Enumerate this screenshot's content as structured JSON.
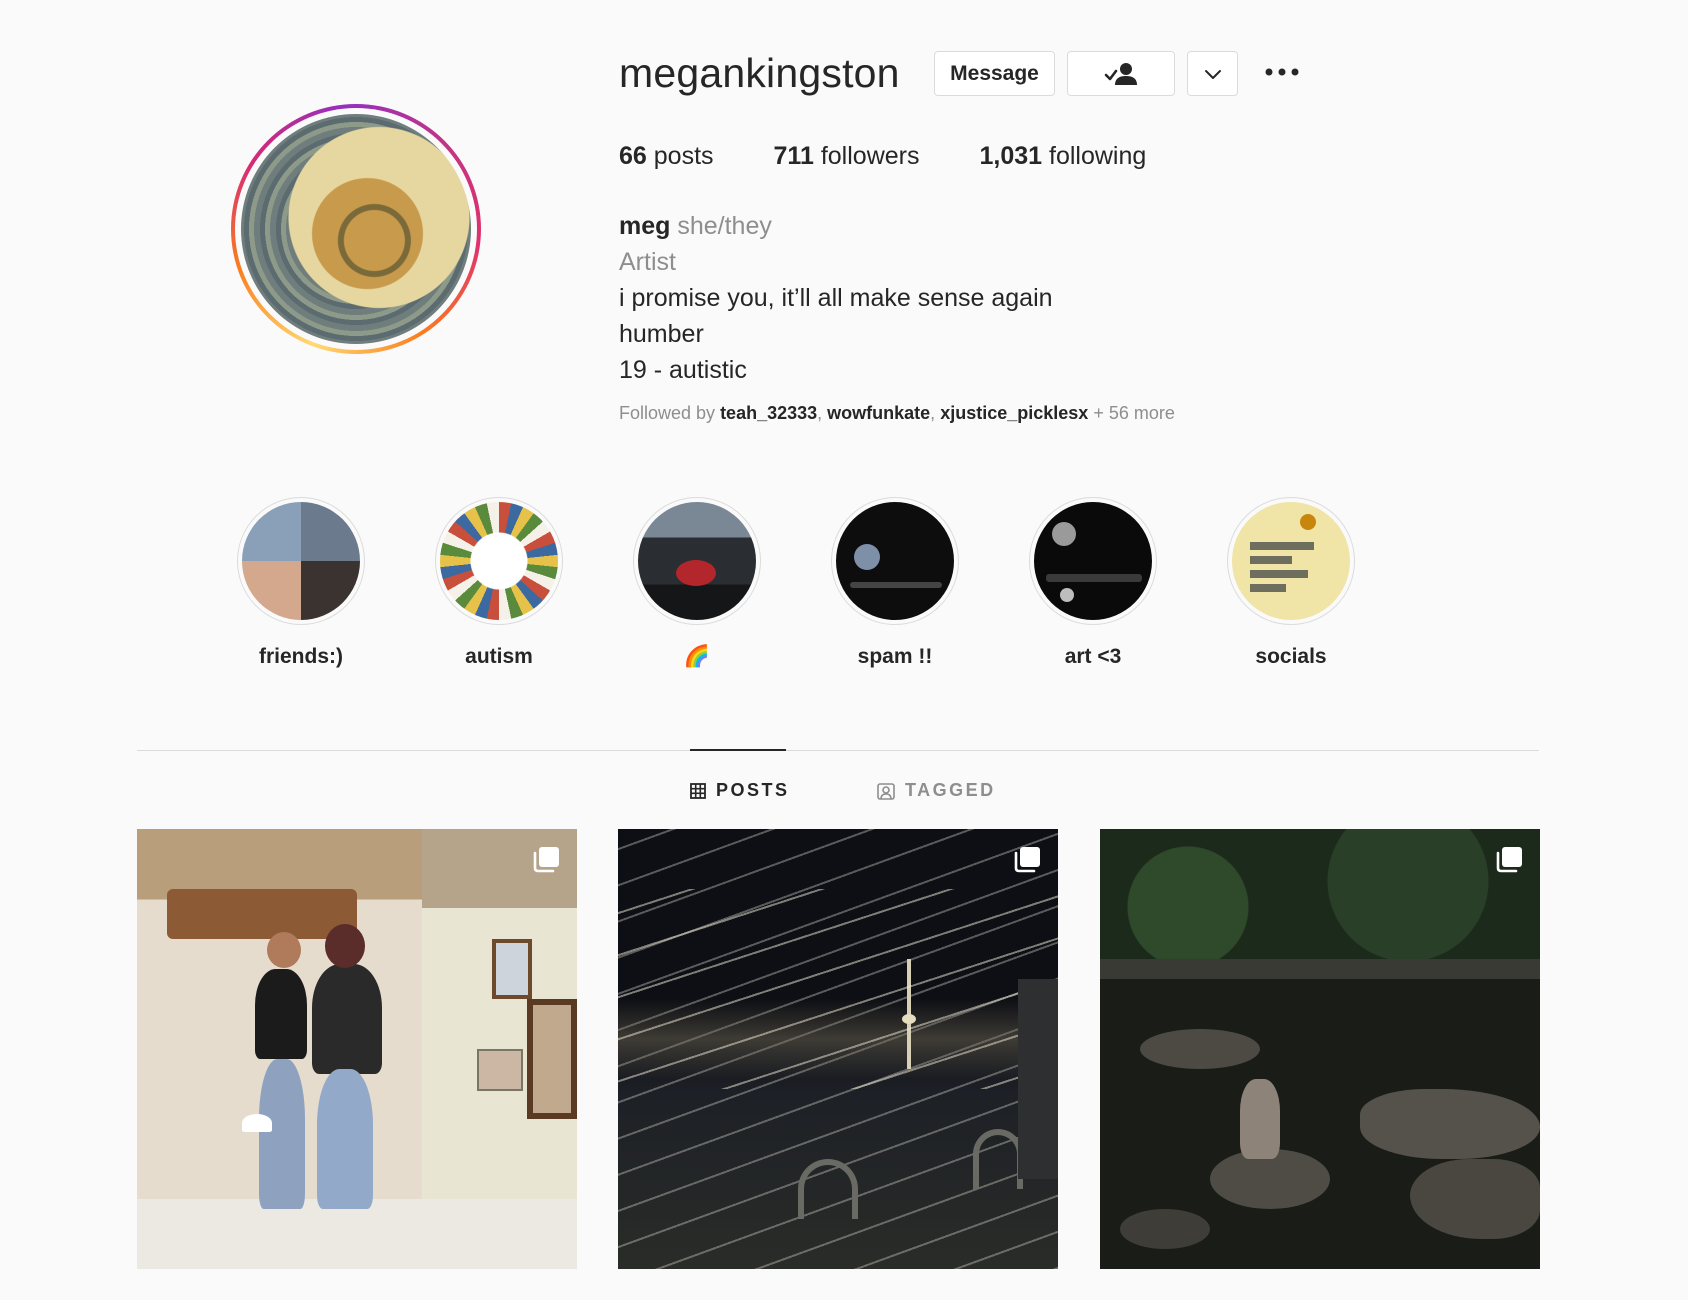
{
  "profile": {
    "username": "megankingston",
    "buttons": {
      "message": "Message"
    },
    "stats": [
      {
        "count": "66",
        "label": "posts"
      },
      {
        "count": "711",
        "label": "followers"
      },
      {
        "count": "1,031",
        "label": "following"
      }
    ],
    "bio": {
      "name": "meg",
      "pronouns": "she/they",
      "category": "Artist",
      "lines": [
        "i promise you, it’ll all make sense again",
        "humber",
        "19 - autistic"
      ]
    },
    "followed_by": {
      "prefix": "Followed by",
      "users": [
        "teah_32333",
        "wowfunkate",
        "xjustice_picklesx"
      ],
      "more": "+ 56 more"
    }
  },
  "highlights": [
    {
      "label": "friends:)"
    },
    {
      "label": "autism"
    },
    {
      "label": "🌈"
    },
    {
      "label": "spam !!"
    },
    {
      "label": "art <3"
    },
    {
      "label": "socials"
    }
  ],
  "tabs": {
    "posts": "POSTS",
    "tagged": "TAGGED"
  },
  "icons": {
    "more": "more-icon",
    "follow": "following-person-check-icon",
    "dropdown": "chevron-down-icon",
    "grid": "grid-icon",
    "tagged": "tagged-icon",
    "multi": "multiple-images-icon"
  },
  "colors": {
    "accent_ring": "#d62976",
    "text": "#262626",
    "muted": "#8e8e8e",
    "border": "#dbdbdb"
  }
}
